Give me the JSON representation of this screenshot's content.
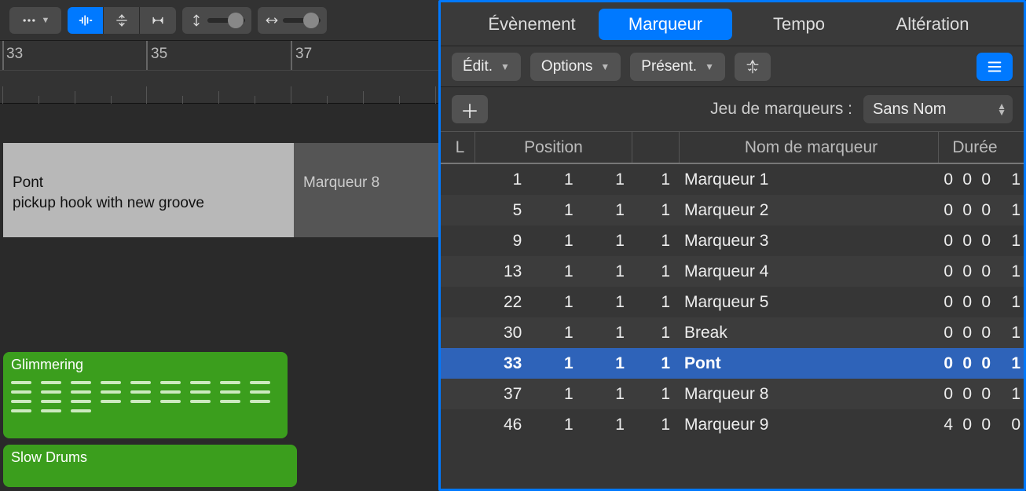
{
  "timeline": {
    "ruler": [
      "33",
      "35",
      "37"
    ],
    "marker_selected": {
      "name": "Pont",
      "note": "pickup hook with new groove"
    },
    "marker_next": "Marqueur 8",
    "region1": "Glimmering",
    "region2": "Slow Drums"
  },
  "tabs": {
    "event": "Évènement",
    "marker": "Marqueur",
    "tempo": "Tempo",
    "signature": "Altération"
  },
  "menus": {
    "edit": "Édit.",
    "options": "Options",
    "view": "Présent."
  },
  "marker_set": {
    "label": "Jeu de marqueurs :",
    "value": "Sans Nom"
  },
  "columns": {
    "l": "L",
    "position": "Position",
    "name": "Nom de marqueur",
    "duration": "Durée"
  },
  "rows": [
    {
      "pos": [
        "1",
        "1",
        "1"
      ],
      "sub": "1",
      "name": "Marqueur 1",
      "dur": [
        "0",
        "0",
        "0",
        "1"
      ],
      "sel": false
    },
    {
      "pos": [
        "5",
        "1",
        "1"
      ],
      "sub": "1",
      "name": "Marqueur 2",
      "dur": [
        "0",
        "0",
        "0",
        "1"
      ],
      "sel": false
    },
    {
      "pos": [
        "9",
        "1",
        "1"
      ],
      "sub": "1",
      "name": "Marqueur 3",
      "dur": [
        "0",
        "0",
        "0",
        "1"
      ],
      "sel": false
    },
    {
      "pos": [
        "13",
        "1",
        "1"
      ],
      "sub": "1",
      "name": "Marqueur 4",
      "dur": [
        "0",
        "0",
        "0",
        "1"
      ],
      "sel": false
    },
    {
      "pos": [
        "22",
        "1",
        "1"
      ],
      "sub": "1",
      "name": "Marqueur 5",
      "dur": [
        "0",
        "0",
        "0",
        "1"
      ],
      "sel": false
    },
    {
      "pos": [
        "30",
        "1",
        "1"
      ],
      "sub": "1",
      "name": "Break",
      "dur": [
        "0",
        "0",
        "0",
        "1"
      ],
      "sel": false
    },
    {
      "pos": [
        "33",
        "1",
        "1"
      ],
      "sub": "1",
      "name": "Pont",
      "dur": [
        "0",
        "0",
        "0",
        "1"
      ],
      "sel": true
    },
    {
      "pos": [
        "37",
        "1",
        "1"
      ],
      "sub": "1",
      "name": "Marqueur 8",
      "dur": [
        "0",
        "0",
        "0",
        "1"
      ],
      "sel": false
    },
    {
      "pos": [
        "46",
        "1",
        "1"
      ],
      "sub": "1",
      "name": "Marqueur 9",
      "dur": [
        "4",
        "0",
        "0",
        "0"
      ],
      "sel": false
    }
  ]
}
